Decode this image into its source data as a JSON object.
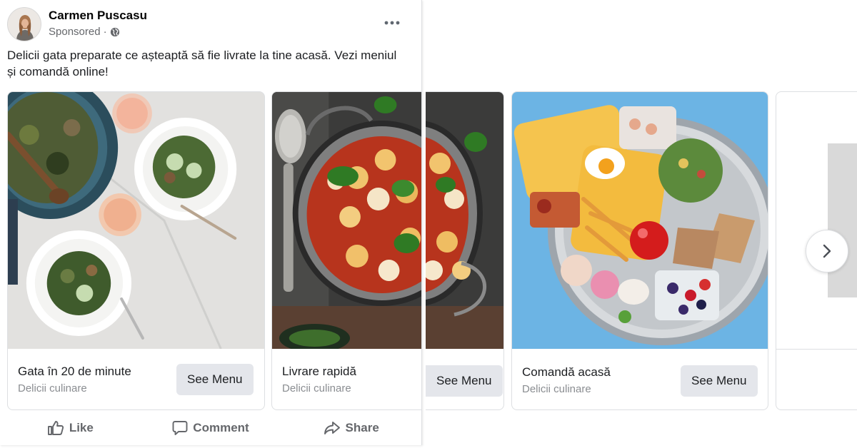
{
  "post": {
    "author": "Carmen Puscasu",
    "sponsored": "Sponsored",
    "sponsored_sep": "·",
    "menu_icon": "more-horizontal-icon",
    "caption": "Delicii gata preparate ce așteaptă să fie livrate la tine acasă. Vezi meniul și comandă online!"
  },
  "cards": [
    {
      "title": "Gata în 20 de minute",
      "subtitle": "Delicii culinare",
      "button": "See Menu"
    },
    {
      "title": "Livrare rapidă",
      "subtitle": "Delicii culinare",
      "button": "See Menu"
    },
    {
      "title": "",
      "subtitle": "",
      "button": "See Menu"
    },
    {
      "title": "Comandă acasă",
      "subtitle": "Delicii culinare",
      "button": "See Menu"
    }
  ],
  "actions": [
    {
      "label": "Like",
      "icon": "thumbs-up-icon"
    },
    {
      "label": "Comment",
      "icon": "comment-icon"
    },
    {
      "label": "Share",
      "icon": "share-icon"
    }
  ],
  "colors": {
    "secondary_text": "#65676b",
    "button_bg": "#e4e6eb",
    "plate_bg": "#6cb4e4"
  }
}
